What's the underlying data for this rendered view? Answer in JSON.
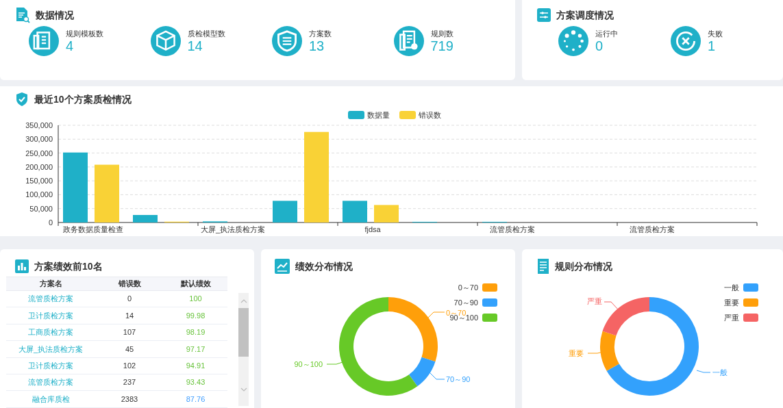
{
  "data_overview": {
    "title": "数据情况",
    "stats": [
      {
        "label": "规则模板数",
        "value": "4"
      },
      {
        "label": "质检模型数",
        "value": "14"
      },
      {
        "label": "方案数",
        "value": "13"
      },
      {
        "label": "规则数",
        "value": "719"
      }
    ]
  },
  "scheduling": {
    "title": "方案调度情况",
    "stats": [
      {
        "label": "运行中",
        "value": "0"
      },
      {
        "label": "失败",
        "value": "1"
      }
    ]
  },
  "recent_quality": {
    "title": "最近10个方案质检情况",
    "chart_data": {
      "type": "bar",
      "categories": [
        "政务数据质量检查",
        null,
        "大屏_执法质检方案",
        null,
        "fjdsa",
        null,
        "流管质检方案",
        null,
        "流管质检方案",
        null
      ],
      "series": [
        {
          "name": "数据量",
          "color": "#1fb0c8",
          "values": [
            252000,
            27000,
            4000,
            78000,
            78000,
            1000,
            1000,
            0,
            0,
            0
          ]
        },
        {
          "name": "错误数",
          "color": "#f9d236",
          "values": [
            208000,
            3000,
            0,
            326000,
            63000,
            0,
            0,
            0,
            0,
            0
          ]
        }
      ],
      "ylim": [
        0,
        350000
      ],
      "grid": true,
      "legend": "top",
      "yticks": [
        {
          "value": 0,
          "label": "0"
        },
        {
          "value": 50000,
          "label": "50,000"
        },
        {
          "value": 100000,
          "label": "100,000"
        },
        {
          "value": 150000,
          "label": "150,000"
        },
        {
          "value": 200000,
          "label": "200,000"
        },
        {
          "value": 250000,
          "label": "250,000"
        },
        {
          "value": 300000,
          "label": "300,000"
        },
        {
          "value": 350000,
          "label": "350,000"
        }
      ]
    }
  },
  "top10": {
    "title": "方案绩效前10名",
    "columns": [
      "方案名",
      "错误数",
      "默认绩效"
    ],
    "rows": [
      {
        "name": "流管质检方案",
        "errors": "0",
        "score": "100",
        "color": "#67c23a"
      },
      {
        "name": "卫计质检方案",
        "errors": "14",
        "score": "99.98",
        "color": "#67c23a"
      },
      {
        "name": "工商质检方案",
        "errors": "107",
        "score": "98.19",
        "color": "#67c23a"
      },
      {
        "name": "大屏_执法质检方案",
        "errors": "45",
        "score": "97.17",
        "color": "#67c23a"
      },
      {
        "name": "卫计质检方案",
        "errors": "102",
        "score": "94.91",
        "color": "#67c23a"
      },
      {
        "name": "流管质检方案",
        "errors": "237",
        "score": "93.43",
        "color": "#67c23a"
      },
      {
        "name": "融合库质检",
        "errors": "2383",
        "score": "87.76",
        "color": "#409eff"
      }
    ]
  },
  "performance": {
    "title": "绩效分布情况",
    "legend": [
      {
        "label": "0～70",
        "color": "#ff9f0a"
      },
      {
        "label": "70～90",
        "color": "#33a1fc"
      },
      {
        "label": "90～100",
        "color": "#67c927"
      }
    ],
    "slice_labels": [
      "0～70",
      "70～90",
      "90～100"
    ]
  },
  "rules": {
    "title": "规则分布情况",
    "legend": [
      {
        "label": "一般",
        "color": "#33a1fc"
      },
      {
        "label": "重要",
        "color": "#ff9f0a"
      },
      {
        "label": "严重",
        "color": "#f56464"
      }
    ],
    "slice_labels": [
      "一般",
      "重要",
      "严重"
    ]
  }
}
